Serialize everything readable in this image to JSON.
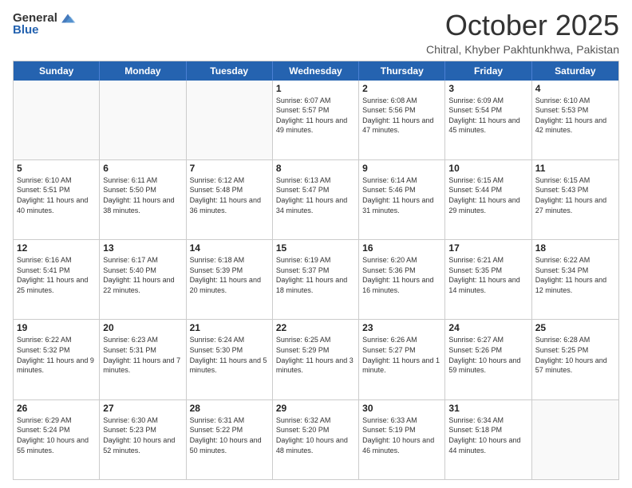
{
  "header": {
    "logo_general": "General",
    "logo_blue": "Blue",
    "month_title": "October 2025",
    "subtitle": "Chitral, Khyber Pakhtunkhwa, Pakistan"
  },
  "weekdays": [
    "Sunday",
    "Monday",
    "Tuesday",
    "Wednesday",
    "Thursday",
    "Friday",
    "Saturday"
  ],
  "weeks": [
    [
      {
        "day": "",
        "sunrise": "",
        "sunset": "",
        "daylight": ""
      },
      {
        "day": "",
        "sunrise": "",
        "sunset": "",
        "daylight": ""
      },
      {
        "day": "",
        "sunrise": "",
        "sunset": "",
        "daylight": ""
      },
      {
        "day": "1",
        "sunrise": "Sunrise: 6:07 AM",
        "sunset": "Sunset: 5:57 PM",
        "daylight": "Daylight: 11 hours and 49 minutes."
      },
      {
        "day": "2",
        "sunrise": "Sunrise: 6:08 AM",
        "sunset": "Sunset: 5:56 PM",
        "daylight": "Daylight: 11 hours and 47 minutes."
      },
      {
        "day": "3",
        "sunrise": "Sunrise: 6:09 AM",
        "sunset": "Sunset: 5:54 PM",
        "daylight": "Daylight: 11 hours and 45 minutes."
      },
      {
        "day": "4",
        "sunrise": "Sunrise: 6:10 AM",
        "sunset": "Sunset: 5:53 PM",
        "daylight": "Daylight: 11 hours and 42 minutes."
      }
    ],
    [
      {
        "day": "5",
        "sunrise": "Sunrise: 6:10 AM",
        "sunset": "Sunset: 5:51 PM",
        "daylight": "Daylight: 11 hours and 40 minutes."
      },
      {
        "day": "6",
        "sunrise": "Sunrise: 6:11 AM",
        "sunset": "Sunset: 5:50 PM",
        "daylight": "Daylight: 11 hours and 38 minutes."
      },
      {
        "day": "7",
        "sunrise": "Sunrise: 6:12 AM",
        "sunset": "Sunset: 5:48 PM",
        "daylight": "Daylight: 11 hours and 36 minutes."
      },
      {
        "day": "8",
        "sunrise": "Sunrise: 6:13 AM",
        "sunset": "Sunset: 5:47 PM",
        "daylight": "Daylight: 11 hours and 34 minutes."
      },
      {
        "day": "9",
        "sunrise": "Sunrise: 6:14 AM",
        "sunset": "Sunset: 5:46 PM",
        "daylight": "Daylight: 11 hours and 31 minutes."
      },
      {
        "day": "10",
        "sunrise": "Sunrise: 6:15 AM",
        "sunset": "Sunset: 5:44 PM",
        "daylight": "Daylight: 11 hours and 29 minutes."
      },
      {
        "day": "11",
        "sunrise": "Sunrise: 6:15 AM",
        "sunset": "Sunset: 5:43 PM",
        "daylight": "Daylight: 11 hours and 27 minutes."
      }
    ],
    [
      {
        "day": "12",
        "sunrise": "Sunrise: 6:16 AM",
        "sunset": "Sunset: 5:41 PM",
        "daylight": "Daylight: 11 hours and 25 minutes."
      },
      {
        "day": "13",
        "sunrise": "Sunrise: 6:17 AM",
        "sunset": "Sunset: 5:40 PM",
        "daylight": "Daylight: 11 hours and 22 minutes."
      },
      {
        "day": "14",
        "sunrise": "Sunrise: 6:18 AM",
        "sunset": "Sunset: 5:39 PM",
        "daylight": "Daylight: 11 hours and 20 minutes."
      },
      {
        "day": "15",
        "sunrise": "Sunrise: 6:19 AM",
        "sunset": "Sunset: 5:37 PM",
        "daylight": "Daylight: 11 hours and 18 minutes."
      },
      {
        "day": "16",
        "sunrise": "Sunrise: 6:20 AM",
        "sunset": "Sunset: 5:36 PM",
        "daylight": "Daylight: 11 hours and 16 minutes."
      },
      {
        "day": "17",
        "sunrise": "Sunrise: 6:21 AM",
        "sunset": "Sunset: 5:35 PM",
        "daylight": "Daylight: 11 hours and 14 minutes."
      },
      {
        "day": "18",
        "sunrise": "Sunrise: 6:22 AM",
        "sunset": "Sunset: 5:34 PM",
        "daylight": "Daylight: 11 hours and 12 minutes."
      }
    ],
    [
      {
        "day": "19",
        "sunrise": "Sunrise: 6:22 AM",
        "sunset": "Sunset: 5:32 PM",
        "daylight": "Daylight: 11 hours and 9 minutes."
      },
      {
        "day": "20",
        "sunrise": "Sunrise: 6:23 AM",
        "sunset": "Sunset: 5:31 PM",
        "daylight": "Daylight: 11 hours and 7 minutes."
      },
      {
        "day": "21",
        "sunrise": "Sunrise: 6:24 AM",
        "sunset": "Sunset: 5:30 PM",
        "daylight": "Daylight: 11 hours and 5 minutes."
      },
      {
        "day": "22",
        "sunrise": "Sunrise: 6:25 AM",
        "sunset": "Sunset: 5:29 PM",
        "daylight": "Daylight: 11 hours and 3 minutes."
      },
      {
        "day": "23",
        "sunrise": "Sunrise: 6:26 AM",
        "sunset": "Sunset: 5:27 PM",
        "daylight": "Daylight: 11 hours and 1 minute."
      },
      {
        "day": "24",
        "sunrise": "Sunrise: 6:27 AM",
        "sunset": "Sunset: 5:26 PM",
        "daylight": "Daylight: 10 hours and 59 minutes."
      },
      {
        "day": "25",
        "sunrise": "Sunrise: 6:28 AM",
        "sunset": "Sunset: 5:25 PM",
        "daylight": "Daylight: 10 hours and 57 minutes."
      }
    ],
    [
      {
        "day": "26",
        "sunrise": "Sunrise: 6:29 AM",
        "sunset": "Sunset: 5:24 PM",
        "daylight": "Daylight: 10 hours and 55 minutes."
      },
      {
        "day": "27",
        "sunrise": "Sunrise: 6:30 AM",
        "sunset": "Sunset: 5:23 PM",
        "daylight": "Daylight: 10 hours and 52 minutes."
      },
      {
        "day": "28",
        "sunrise": "Sunrise: 6:31 AM",
        "sunset": "Sunset: 5:22 PM",
        "daylight": "Daylight: 10 hours and 50 minutes."
      },
      {
        "day": "29",
        "sunrise": "Sunrise: 6:32 AM",
        "sunset": "Sunset: 5:20 PM",
        "daylight": "Daylight: 10 hours and 48 minutes."
      },
      {
        "day": "30",
        "sunrise": "Sunrise: 6:33 AM",
        "sunset": "Sunset: 5:19 PM",
        "daylight": "Daylight: 10 hours and 46 minutes."
      },
      {
        "day": "31",
        "sunrise": "Sunrise: 6:34 AM",
        "sunset": "Sunset: 5:18 PM",
        "daylight": "Daylight: 10 hours and 44 minutes."
      },
      {
        "day": "",
        "sunrise": "",
        "sunset": "",
        "daylight": ""
      }
    ]
  ]
}
